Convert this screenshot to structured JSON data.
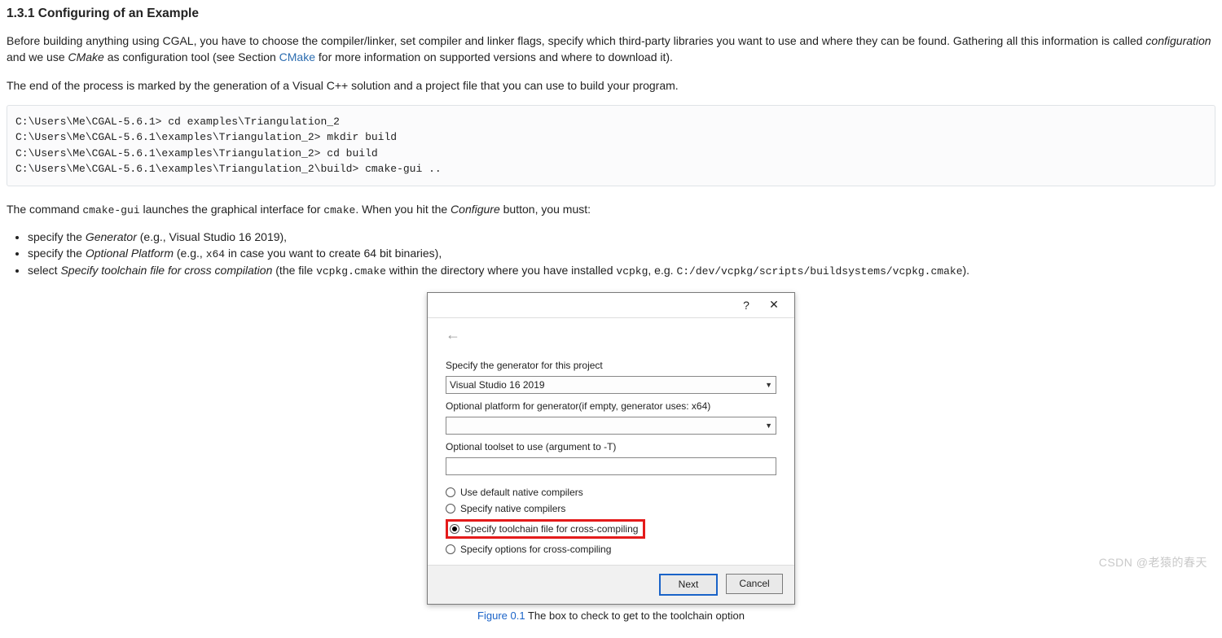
{
  "heading": "1.3.1 Configuring of an Example",
  "para1": {
    "a": "Before building anything using CGAL, you have to choose the compiler/linker, set compiler and linker flags, specify which third-party libraries you want to use and where they can be found. Gathering all this information is called ",
    "it1": "configuration",
    "b": " and we use ",
    "it2": "CMake",
    "c": " as configuration tool (see Section ",
    "link": "CMake",
    "d": " for more information on supported versions and where to download it)."
  },
  "para2": "The end of the process is marked by the generation of a Visual C++ solution and a project file that you can use to build your program.",
  "code": "C:\\Users\\Me\\CGAL-5.6.1> cd examples\\Triangulation_2\nC:\\Users\\Me\\CGAL-5.6.1\\examples\\Triangulation_2> mkdir build\nC:\\Users\\Me\\CGAL-5.6.1\\examples\\Triangulation_2> cd build\nC:\\Users\\Me\\CGAL-5.6.1\\examples\\Triangulation_2\\build> cmake-gui ..",
  "para3": {
    "a": "The command ",
    "tt1": "cmake-gui",
    "b": " launches the graphical interface for ",
    "tt2": "cmake",
    "c": ". When you hit the ",
    "it": "Configure",
    "d": " button, you must:"
  },
  "bullets": {
    "b1": {
      "a": "specify the ",
      "it": "Generator",
      "b": " (e.g., Visual Studio 16 2019),"
    },
    "b2": {
      "a": "specify the ",
      "it": "Optional Platform",
      "b": " (e.g., ",
      "tt": "x64",
      "c": " in case you want to create 64 bit binaries),"
    },
    "b3": {
      "a": "select ",
      "it": "Specify toolchain file for cross compilation",
      "b": " (the file ",
      "tt1": "vcpkg.cmake",
      "c": " within the directory where you have installed ",
      "tt2": "vcpkg",
      "d": ", e.g. ",
      "tt3": "C:/dev/vcpkg/scripts/buildsystems/vcpkg.cmake",
      "e": ")."
    }
  },
  "dialog": {
    "help": "?",
    "close": "✕",
    "back": "←",
    "label_gen": "Specify the generator for this project",
    "gen_value": "Visual Studio 16 2019",
    "label_platform": "Optional platform for generator(if empty, generator uses: x64)",
    "label_toolset": "Optional toolset to use (argument to -T)",
    "radio1": "Use default native compilers",
    "radio2": "Specify native compilers",
    "radio3": "Specify toolchain file for cross-compiling",
    "radio4": "Specify options for cross-compiling",
    "btn_next": "Next",
    "btn_cancel": "Cancel"
  },
  "caption": {
    "fignum": "Figure 0.1",
    "text": " The box to check to get to the toolchain option"
  },
  "watermark": "CSDN @老猿的春天"
}
